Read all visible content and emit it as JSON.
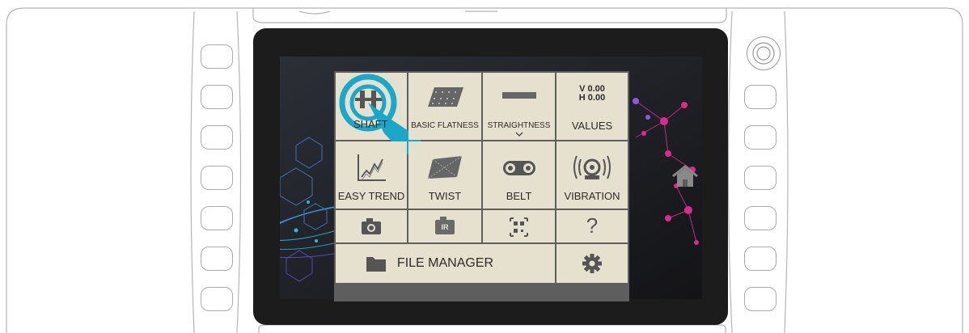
{
  "menu": {
    "shaft": "SHAFT",
    "basic_flatness": "BASIC FLATNESS",
    "straightness": "STRAIGHTNESS",
    "values": "VALUES",
    "values_v": "V 0.00",
    "values_h": "H 0.00",
    "easy_trend": "EASY TREND",
    "twist": "TWIST",
    "belt": "BELT",
    "vibration": "VIBRATION",
    "ir_badge": "IR",
    "help": "?",
    "file_manager": "FILE MANAGER"
  },
  "icons": {
    "shaft": "shaft-coupling-icon",
    "tap": "tap-hand-icon",
    "basic_flatness": "flatness-plate-icon",
    "straightness": "straightness-bar-icon",
    "easy_trend": "trend-chart-icon",
    "twist": "twist-plate-icon",
    "belt": "belt-pulley-icon",
    "vibration": "vibration-sensor-icon",
    "camera": "camera-icon",
    "ir_camera": "ir-camera-icon",
    "qr": "qr-scan-icon",
    "folder": "folder-icon",
    "settings": "gear-icon",
    "home": "home-icon"
  },
  "colors": {
    "tile": "#e6e1cf",
    "tile_border": "#5e5e5e",
    "accent_cyan": "#1aa7c9",
    "network_pink": "#e0298f",
    "network_blue": "#2fb6e6"
  }
}
